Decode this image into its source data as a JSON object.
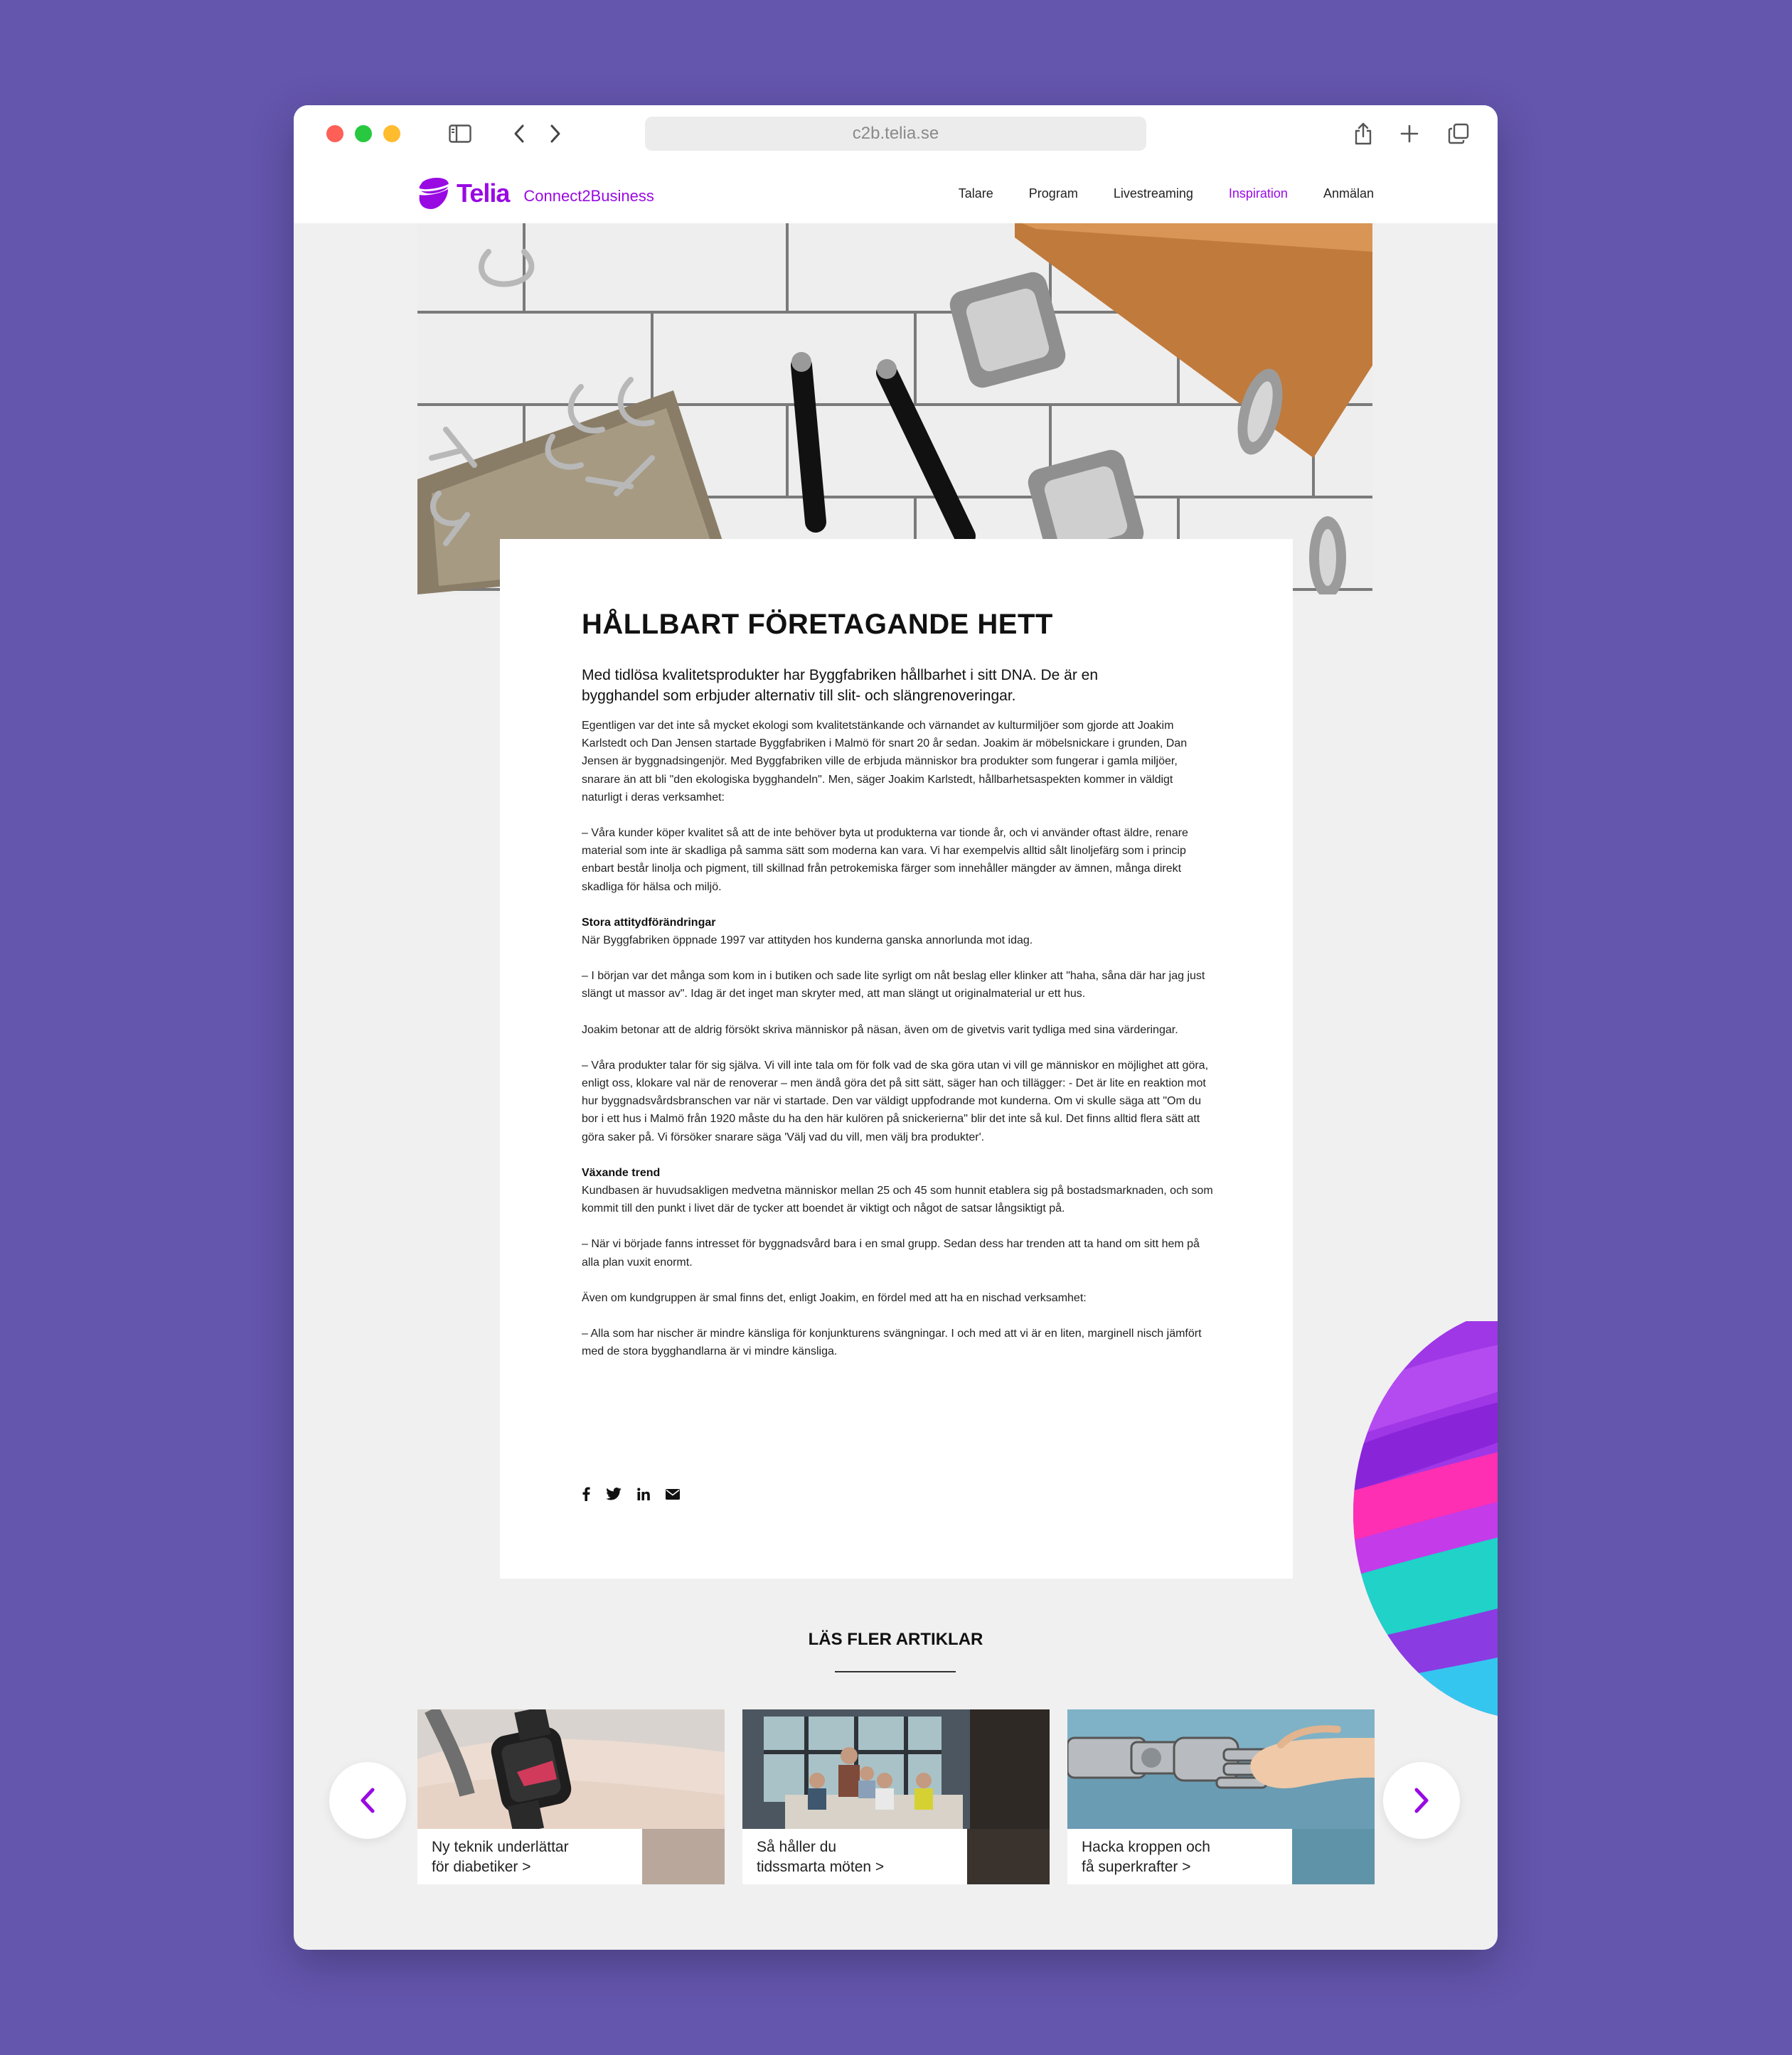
{
  "browser": {
    "url": "c2b.telia.se"
  },
  "site": {
    "logo_text": "Telia",
    "logo_subtitle": "Connect2Business",
    "nav": [
      {
        "label": "Talare",
        "active": false
      },
      {
        "label": "Program",
        "active": false
      },
      {
        "label": "Livestreaming",
        "active": false
      },
      {
        "label": "Inspiration",
        "active": true
      },
      {
        "label": "Anmälan",
        "active": false
      }
    ],
    "accent_color": "#990ae3"
  },
  "article": {
    "title": "HÅLLBART FÖRETAGANDE HETT",
    "lead": "Med tidlösa kvalitetsprodukter har Byggfabriken hållbarhet i sitt DNA. De är en bygghandel som erbjuder alternativ till slit- och slängrenoveringar.",
    "p1": "Egentligen var det inte så mycket ekologi som kvalitetstänkande och värnandet av kulturmiljöer som gjorde att Joakim Karlstedt och Dan Jensen startade Byggfabriken i Malmö för snart 20 år sedan. Joakim är möbelsnickare i grunden, Dan Jensen är byggnadsingenjör. Med Byggfabriken ville de erbjuda människor bra produkter som fungerar i gamla miljöer, snarare än att bli \"den ekologiska bygghandeln\". Men, säger Joakim Karlstedt, hållbarhetsaspekten kommer in väldigt naturligt i deras verksamhet:",
    "p2": "– Våra kunder köper kvalitet så att de inte behöver byta ut produkterna var tionde år, och vi använder oftast äldre, renare material som inte är skadliga på samma sätt som moderna kan vara. Vi har exempelvis alltid sålt linoljefärg som i princip enbart består linolja och pigment, till skillnad från petrokemiska färger som innehåller mängder av ämnen, många direkt skadliga för hälsa och miljö.",
    "h2": "Stora attitydförändringar",
    "p3": "När Byggfabriken öppnade 1997 var attityden hos kunderna ganska annorlunda mot idag.",
    "p4": "– I början var det många som kom in i butiken och sade lite syrligt om nåt beslag eller klinker att \"haha, såna där har jag just slängt ut massor av\". Idag är det inget man skryter med, att man slängt ut originalmaterial ur ett hus.",
    "p5": "Joakim betonar att de aldrig försökt skriva människor på näsan, även om de givetvis varit tydliga med sina värderingar.",
    "p6": "– Våra produkter talar för sig själva. Vi vill inte tala om för folk vad de ska göra utan vi vill ge människor en möjlighet att göra, enligt oss, klokare val när de renoverar – men ändå göra det på sitt sätt, säger han och tillägger: - Det är lite en reaktion mot hur byggnadsvårdsbranschen var när vi startade. Den var väldigt uppfodrande mot kunderna. Om vi skulle säga att \"Om du bor i ett hus i Malmö från 1920 måste du ha den här kulören på snickerierna\" blir det inte så kul. Det finns alltid flera sätt att göra saker på. Vi försöker snarare säga 'Välj vad du vill, men välj bra produkter'.",
    "h3": "Växande trend",
    "p7": "Kundbasen är huvudsakligen medvetna människor mellan 25 och 45 som hunnit etablera sig på bostadsmarknaden, och som kommit till den punkt i livet där de tycker att boendet är viktigt och något de satsar långsiktigt på.",
    "p8": "– När vi började fanns intresset för byggnadsvård bara i en smal grupp. Sedan dess har trenden att ta hand om sitt hem på alla plan vuxit enormt.",
    "p9": "Även om kundgruppen är smal finns det, enligt Joakim, en fördel med att ha en nischad verksamhet:",
    "p10": "– Alla som har nischer är mindre känsliga för konjunkturens svängningar. I och med att vi är en liten, marginell nisch jämfört med de stora bygghandlarna är vi mindre känsliga.",
    "share_icons": [
      "facebook-icon",
      "twitter-icon",
      "linkedin-icon",
      "mail-icon"
    ]
  },
  "more": {
    "title": "LÄS FLER ARTIKLAR",
    "cards": [
      {
        "line1": "Ny teknik underlättar",
        "line2": "för diabetiker  >"
      },
      {
        "line1": "Så håller du",
        "line2": "tidssmarta möten  >"
      },
      {
        "line1": "Hacka kroppen och",
        "line2": "få superkrafter  >"
      }
    ]
  }
}
